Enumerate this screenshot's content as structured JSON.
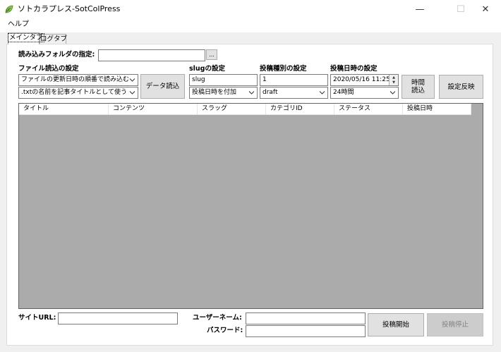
{
  "window": {
    "title": "ソトカラプレス-SotColPress",
    "minimize_glyph": "—",
    "maximize_glyph": "☐",
    "close_glyph": "✕",
    "icon": "leaf-app-icon"
  },
  "menu": {
    "items": [
      {
        "label": "ヘルプ"
      }
    ]
  },
  "tabs": [
    {
      "label": "メインタブ",
      "active": true
    },
    {
      "label": "ログタブ",
      "active": false
    }
  ],
  "folder": {
    "label": "読み込みフォルダの指定:",
    "value": "",
    "browse_label": "..."
  },
  "file_read": {
    "label": "ファイル読込の設定",
    "order_select": "ファイルの更新日時の順番で読み込む",
    "title_select": ".txtの名前を記事タイトルとして使う",
    "load_button": "データ読込"
  },
  "slug": {
    "label": "slugの設定",
    "value": "slug",
    "mode_select": "投稿日時を付加"
  },
  "post_type": {
    "label": "投稿種別の設定",
    "value": "1",
    "status_select": "draft"
  },
  "post_datetime": {
    "label": "投稿日時の設定",
    "value": "2020/05/16 11:25",
    "interval_select": "24時間",
    "time_load_button_line1": "時間",
    "time_load_button_line2": "読込",
    "apply_button": "設定反映"
  },
  "grid": {
    "columns": [
      "タイトル",
      "コンテンツ",
      "スラッグ",
      "カテゴリID",
      "ステータス",
      "投稿日時"
    ],
    "rows": []
  },
  "footer": {
    "site_url_label": "サイトURL:",
    "site_url_value": "",
    "username_label": "ユーザーネーム:",
    "username_value": "",
    "password_label": "パスワード:",
    "password_value": "",
    "start_button": "投稿開始",
    "stop_button": "投稿停止"
  },
  "colors": {
    "window_bg": "#f0f0f0",
    "grid_bg": "#ababab",
    "button_bg": "#e1e1e1",
    "icon_green": "#7cb342"
  }
}
